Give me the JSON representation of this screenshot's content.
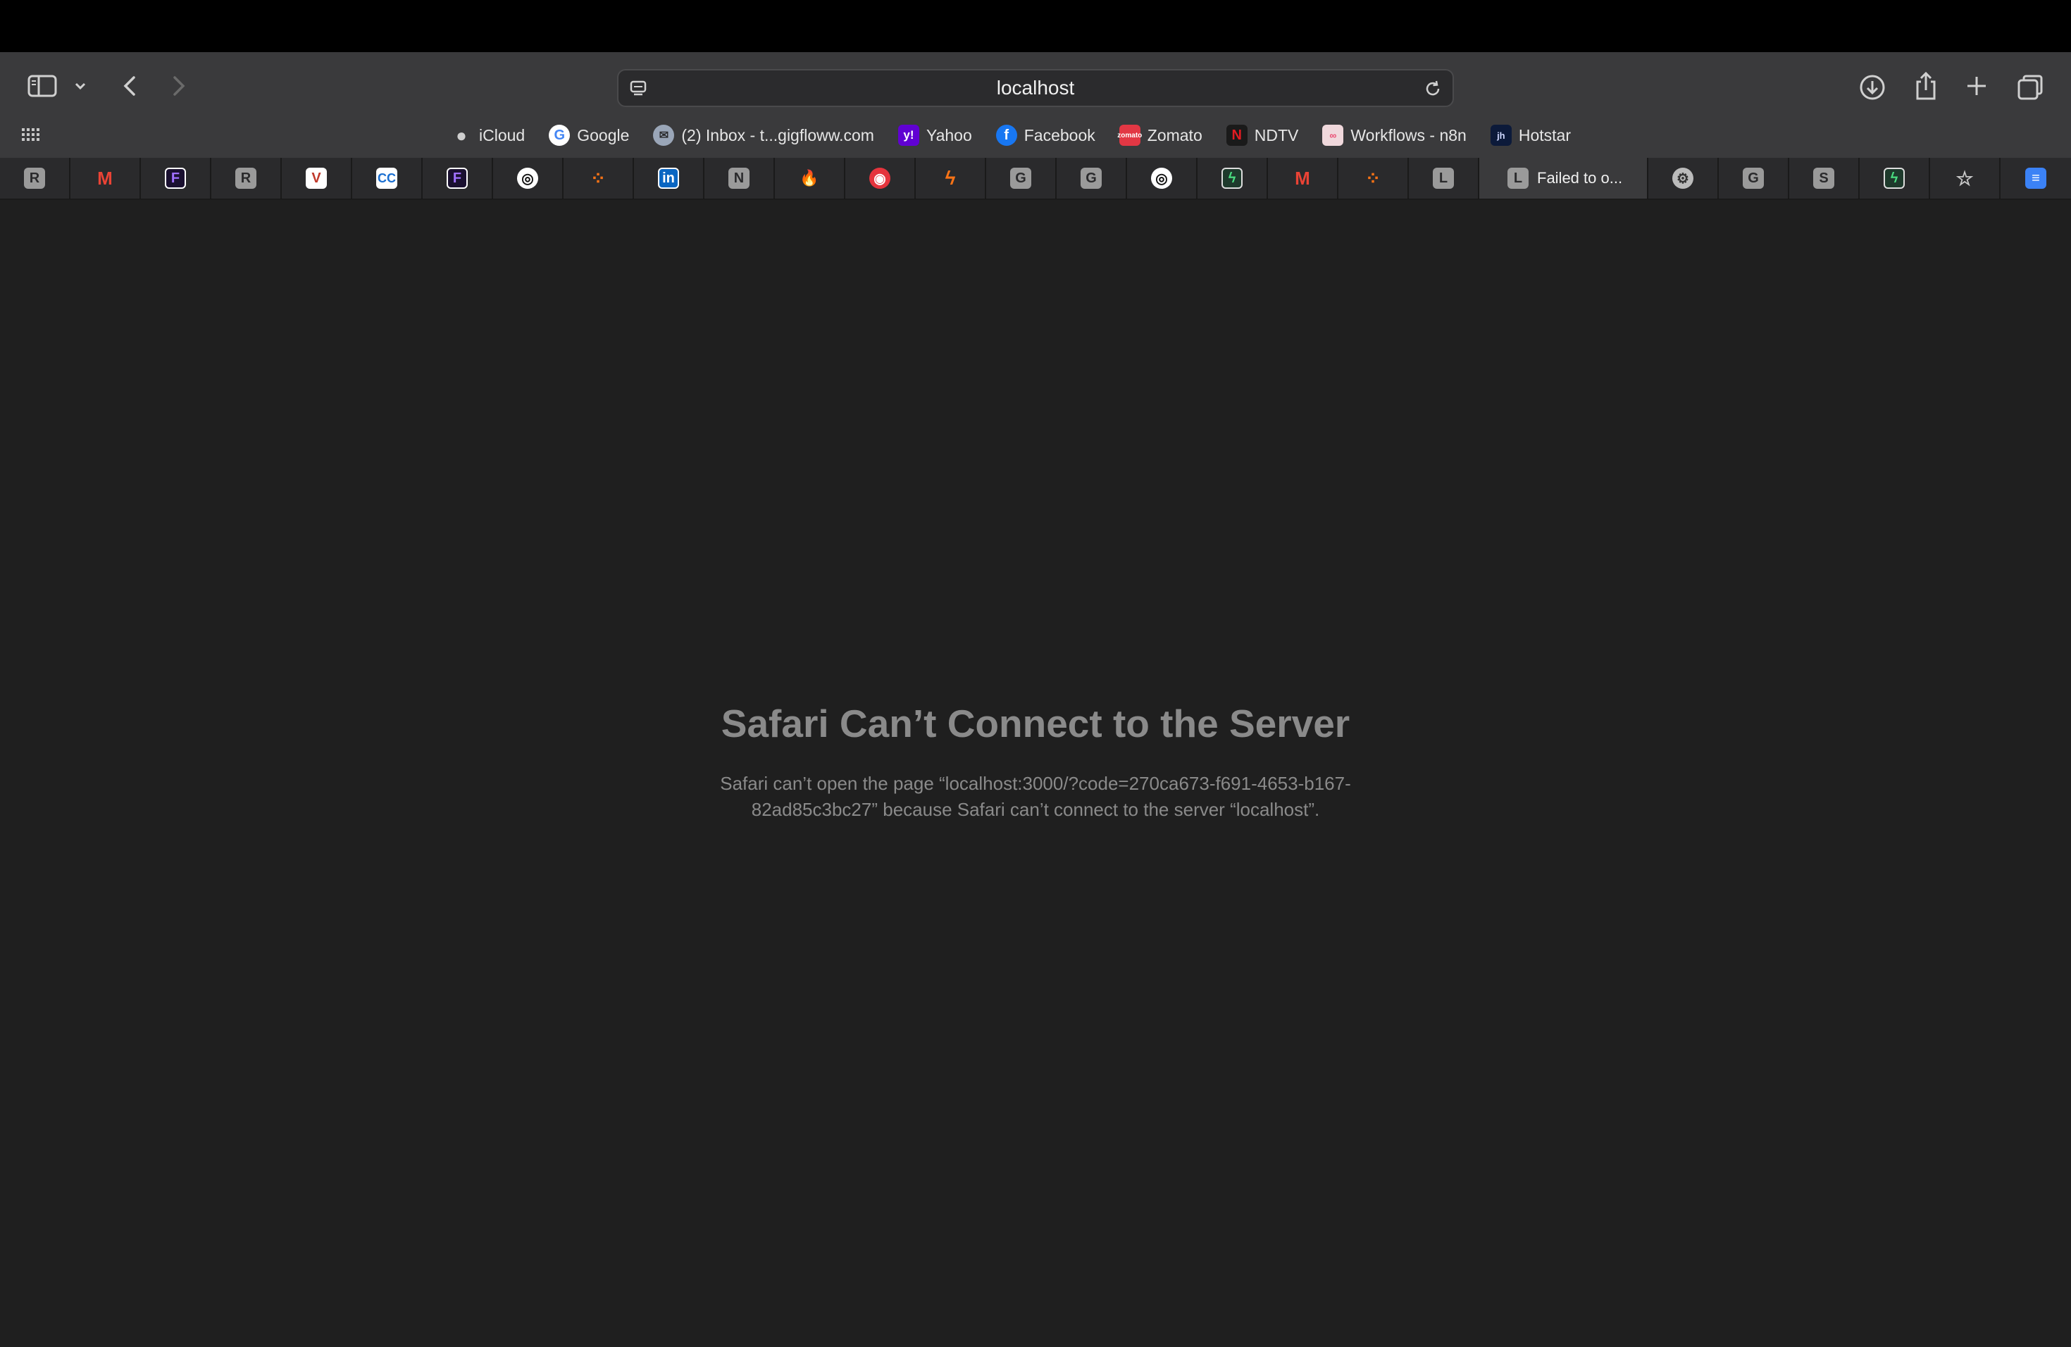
{
  "window": {
    "url": "localhost"
  },
  "bookmarks": [
    {
      "label": "iCloud",
      "icon": "apple-icon"
    },
    {
      "label": "Google",
      "icon": "google-icon"
    },
    {
      "label": "(2) Inbox - t...gigfloww.com",
      "icon": "mail-icon"
    },
    {
      "label": "Yahoo",
      "icon": "yahoo-icon"
    },
    {
      "label": "Facebook",
      "icon": "facebook-icon"
    },
    {
      "label": "Zomato",
      "icon": "zomato-icon"
    },
    {
      "label": "NDTV",
      "icon": "ndtv-icon"
    },
    {
      "label": "Workflows - n8n",
      "icon": "n8n-icon"
    },
    {
      "label": "Hotstar",
      "icon": "hotstar-icon"
    }
  ],
  "tabs": [
    {
      "letter": "R"
    },
    {
      "letter": "M"
    },
    {
      "letter": "F"
    },
    {
      "letter": "R"
    },
    {
      "letter": "V"
    },
    {
      "letter": "CC"
    },
    {
      "letter": "F"
    },
    {
      "letter": "◎"
    },
    {
      "letter": "⁘"
    },
    {
      "letter": "in"
    },
    {
      "letter": "N"
    },
    {
      "letter": "🔥"
    },
    {
      "letter": "◉"
    },
    {
      "letter": "ϟ"
    },
    {
      "letter": "G"
    },
    {
      "letter": "G"
    },
    {
      "letter": "◎"
    },
    {
      "letter": "ϟ"
    },
    {
      "letter": "M"
    },
    {
      "letter": "⁘"
    },
    {
      "letter": "L"
    }
  ],
  "active_tab": {
    "letter": "L",
    "title": "Failed to o..."
  },
  "tabs_after": [
    {
      "letter": "⚙"
    },
    {
      "letter": "G"
    },
    {
      "letter": "S"
    },
    {
      "letter": "ϟ"
    },
    {
      "letter": "☆"
    },
    {
      "letter": "≡"
    }
  ],
  "error": {
    "title": "Safari Can’t Connect to the Server",
    "message": "Safari can’t open the page “localhost:3000/?code=270ca673-f691-4653-b167-82ad85c3bc27” because Safari can’t connect to the server “localhost”."
  }
}
